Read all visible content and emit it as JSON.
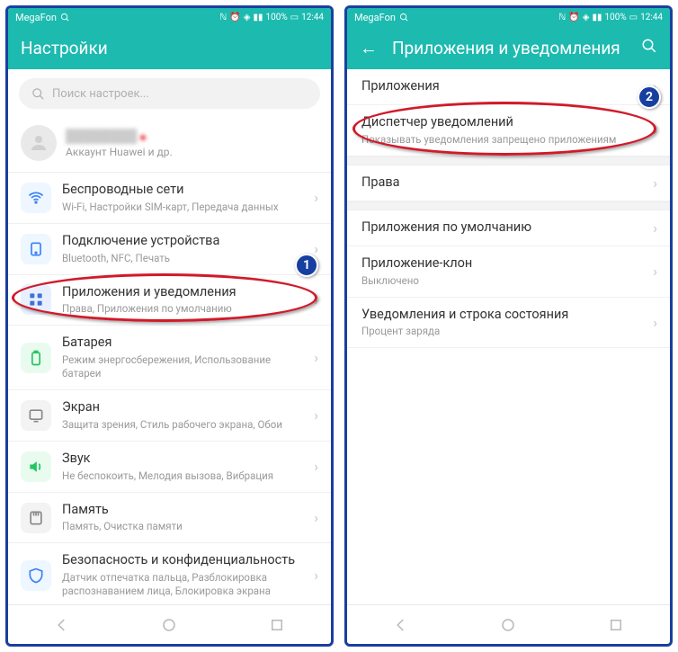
{
  "status": {
    "carrier": "MegaFon",
    "battery": "100%",
    "time": "12:44"
  },
  "left": {
    "title": "Настройки",
    "search_placeholder": "Поиск настроек...",
    "account_sub": "Аккаунт Huawei и др.",
    "items": [
      {
        "title": "Беспроводные сети",
        "sub": "Wi-Fi, Настройки SIM-карт, Передача данных"
      },
      {
        "title": "Подключение устройства",
        "sub": "Bluetooth, NFC, Печать"
      },
      {
        "title": "Приложения и уведомления",
        "sub": "Права, Приложения по умолчанию"
      },
      {
        "title": "Батарея",
        "sub": "Режим энергосбережения, Использование батареи"
      },
      {
        "title": "Экран",
        "sub": "Защита зрения, Стиль рабочего экрана, Обои"
      },
      {
        "title": "Звук",
        "sub": "Не беспокоить, Мелодия вызова, Вибрация"
      },
      {
        "title": "Память",
        "sub": "Память, Очистка памяти"
      },
      {
        "title": "Безопасность и конфиденциальность",
        "sub": "Датчик отпечатка пальца, Разблокировка распознаванием лица, Блокировка экрана"
      }
    ],
    "badge": "1"
  },
  "right": {
    "title": "Приложения и уведомления",
    "items": [
      {
        "title": "Приложения",
        "sub": ""
      },
      {
        "title": "Диспетчер уведомлений",
        "sub": "Показывать уведомления запрещено приложениям"
      },
      {
        "title": "Права",
        "sub": ""
      },
      {
        "title": "Приложения по умолчанию",
        "sub": ""
      },
      {
        "title": "Приложение-клон",
        "sub": "Выключено"
      },
      {
        "title": "Уведомления и строка состояния",
        "sub": "Процент заряда"
      }
    ],
    "badge": "2"
  }
}
